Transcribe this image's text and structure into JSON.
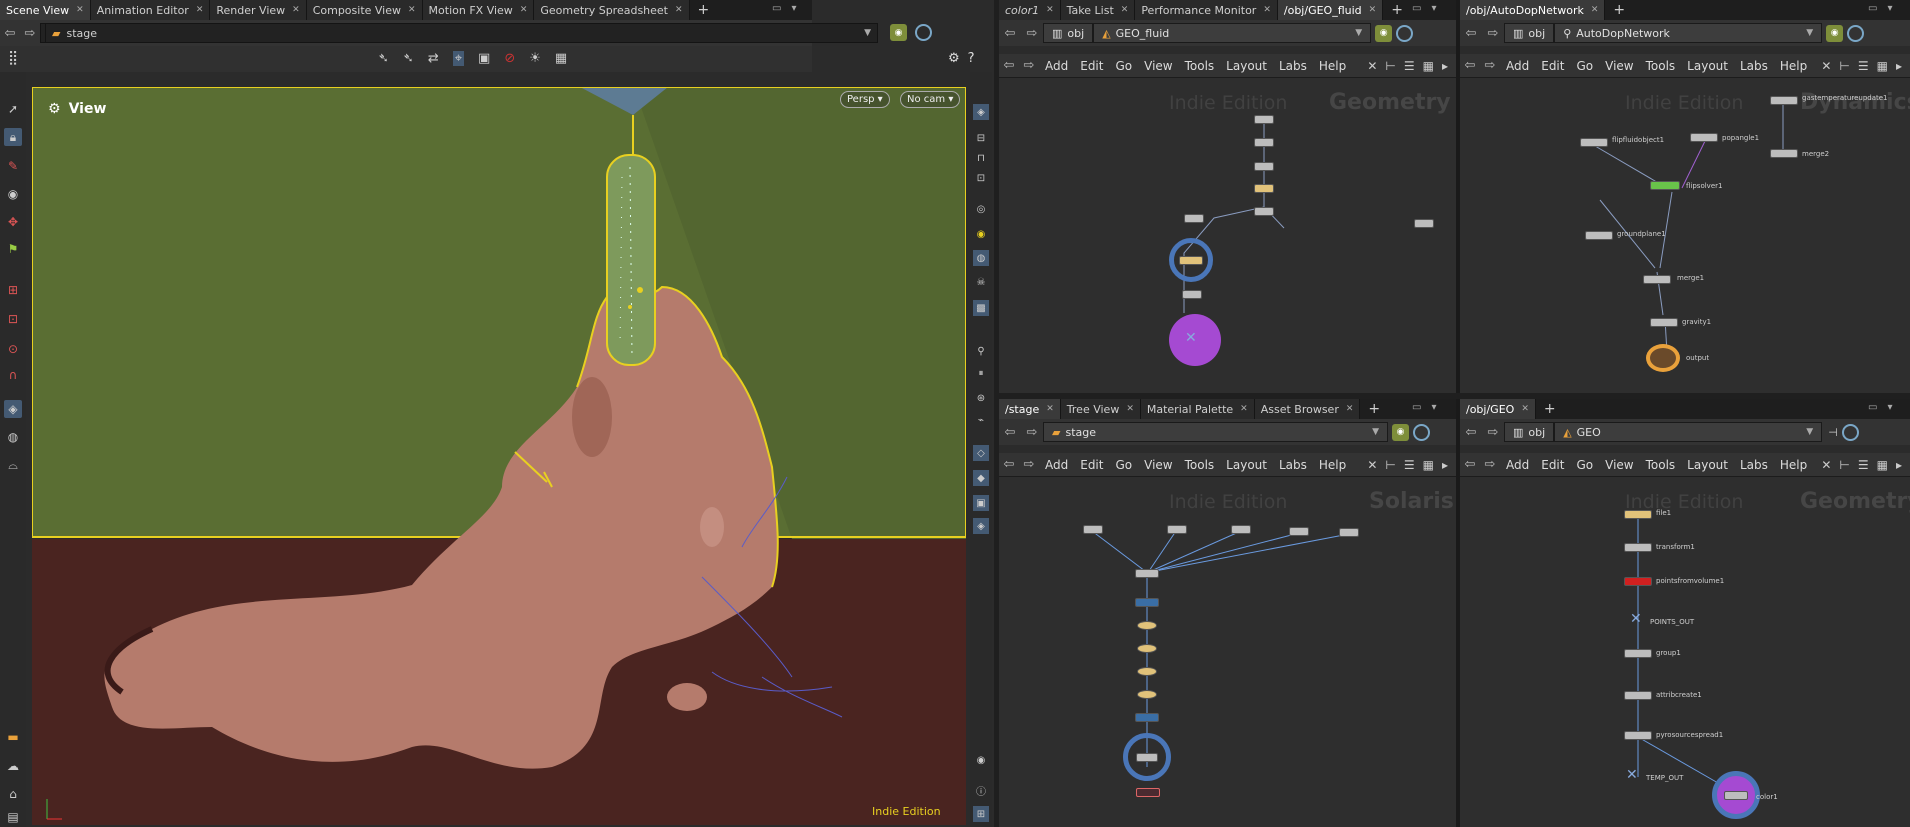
{
  "scene_tabs": [
    "Scene View",
    "Animation Editor",
    "Render View",
    "Composite View",
    "Motion FX View",
    "Geometry Spreadsheet"
  ],
  "scene_path": "stage",
  "viewport": {
    "title": "View",
    "camera_mode": "Persp",
    "camera": "No cam",
    "edition": "Indie Edition"
  },
  "panes": {
    "geo_fluid": {
      "tabs": [
        "color1",
        "Take List",
        "Performance Monitor",
        "/obj/GEO_fluid"
      ],
      "crumb_root": "obj",
      "crumb_node": "GEO_fluid",
      "watermark_edition": "Indie Edition",
      "watermark_context": "Geometry"
    },
    "autodop": {
      "tabs": [
        "/obj/AutoDopNetwork"
      ],
      "crumb_root": "obj",
      "crumb_node": "AutoDopNetwork",
      "watermark_edition": "Indie Edition",
      "watermark_context": "Dynamics",
      "nodes": {
        "flip": "flipfluidobject1",
        "popangle": "popangle1",
        "merge2": "merge2",
        "gasupdate": "gastemperatureupdate1",
        "solver": "flipsolver1",
        "ground": "groundplane1",
        "merge1": "merge1",
        "gravity": "gravity1",
        "output": "output"
      }
    },
    "stage": {
      "tabs": [
        "/stage",
        "Tree View",
        "Material Palette",
        "Asset Browser"
      ],
      "crumb_node": "stage",
      "watermark_edition": "Indie Edition",
      "watermark_context": "Solaris"
    },
    "geo": {
      "tabs": [
        "/obj/GEO"
      ],
      "crumb_root": "obj",
      "crumb_node": "GEO",
      "watermark_edition": "Indie Edition",
      "watermark_context": "Geometry",
      "nodes": {
        "file": "file1",
        "transform": "transform1",
        "pts": "pointsfromvolume1",
        "points_out": "POINTS_OUT",
        "group": "group1",
        "attr": "attribcreate1",
        "pyro": "pyrosourcespread1",
        "temp_out": "TEMP_OUT",
        "color": "color1"
      }
    }
  },
  "menus": [
    "Add",
    "Edit",
    "Go",
    "View",
    "Tools",
    "Layout",
    "Labs",
    "Help"
  ],
  "colors": {
    "backwall": "#5a6e33",
    "floor": "#4a2420",
    "fluid": "#b57b6c",
    "selection": "#e8d020",
    "node_ring": "#4a76b8",
    "output_node": "#a54ad2"
  }
}
